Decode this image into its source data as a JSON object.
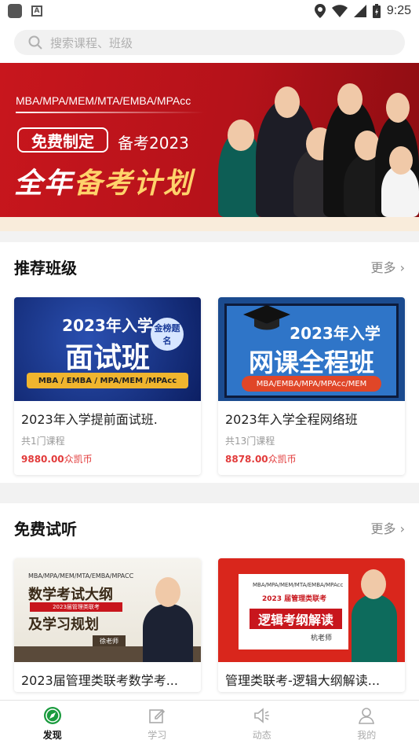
{
  "status_bar": {
    "time": "9:25"
  },
  "search": {
    "placeholder": "搜索课程、班级"
  },
  "banner": {
    "programs": "MBA/MPA/MEM/MTA/EMBA/MPAcc",
    "badge": "免费制定",
    "subtitle": "备考2023",
    "headline_white": "全年",
    "headline_yellow": "备考计划"
  },
  "recommended": {
    "title": "推荐班级",
    "more": "更多 ›",
    "cards": [
      {
        "thumb_year": "2023年入学",
        "thumb_main": "面试班",
        "thumb_seal": "金榜题名",
        "thumb_sub": "MBA / EMBA / MPA/MEM /MPAcc",
        "title": "2023年入学提前面试班.",
        "count": "共1门课程",
        "price": "9880.00",
        "currency": "众凯币"
      },
      {
        "thumb_year": "2023年入学",
        "thumb_main": "网课全程班",
        "thumb_sub": "MBA/EMBA/MPA/MPAcc/MEM",
        "title": "2023年入学全程网络班",
        "count": "共13门课程",
        "price": "8878.00",
        "currency": "众凯币"
      }
    ]
  },
  "free_trial": {
    "title": "免费试听",
    "more": "更多 ›",
    "cards": [
      {
        "thumb_programs": "MBA/MPA/MEM/MTA/EMBA/MPACC",
        "thumb_main": "数学考试大纲",
        "thumb_band": "2023届管理类联考",
        "thumb_main2": "及学习规划",
        "thumb_teacher": "徐老师",
        "title": "2023届管理类联考数学考..."
      },
      {
        "thumb_programs": "MBA/MPA/MEM/MTA/EMBA/MPAcc",
        "thumb_band": "2023 届管理类联考",
        "thumb_main": "逻辑考纲解读",
        "thumb_teacher": "杭老师",
        "title": "管理类联考-逻辑大纲解读..."
      }
    ]
  },
  "tabbar": {
    "tabs": [
      {
        "label": "发现",
        "icon": "compass-icon",
        "active": true
      },
      {
        "label": "学习",
        "icon": "edit-icon"
      },
      {
        "label": "动态",
        "icon": "speaker-icon"
      },
      {
        "label": "我的",
        "icon": "user-icon"
      }
    ]
  },
  "colors": {
    "brand_red": "#c8161d",
    "accent_green": "#1a9b3e",
    "price_red": "#e23b3b"
  }
}
